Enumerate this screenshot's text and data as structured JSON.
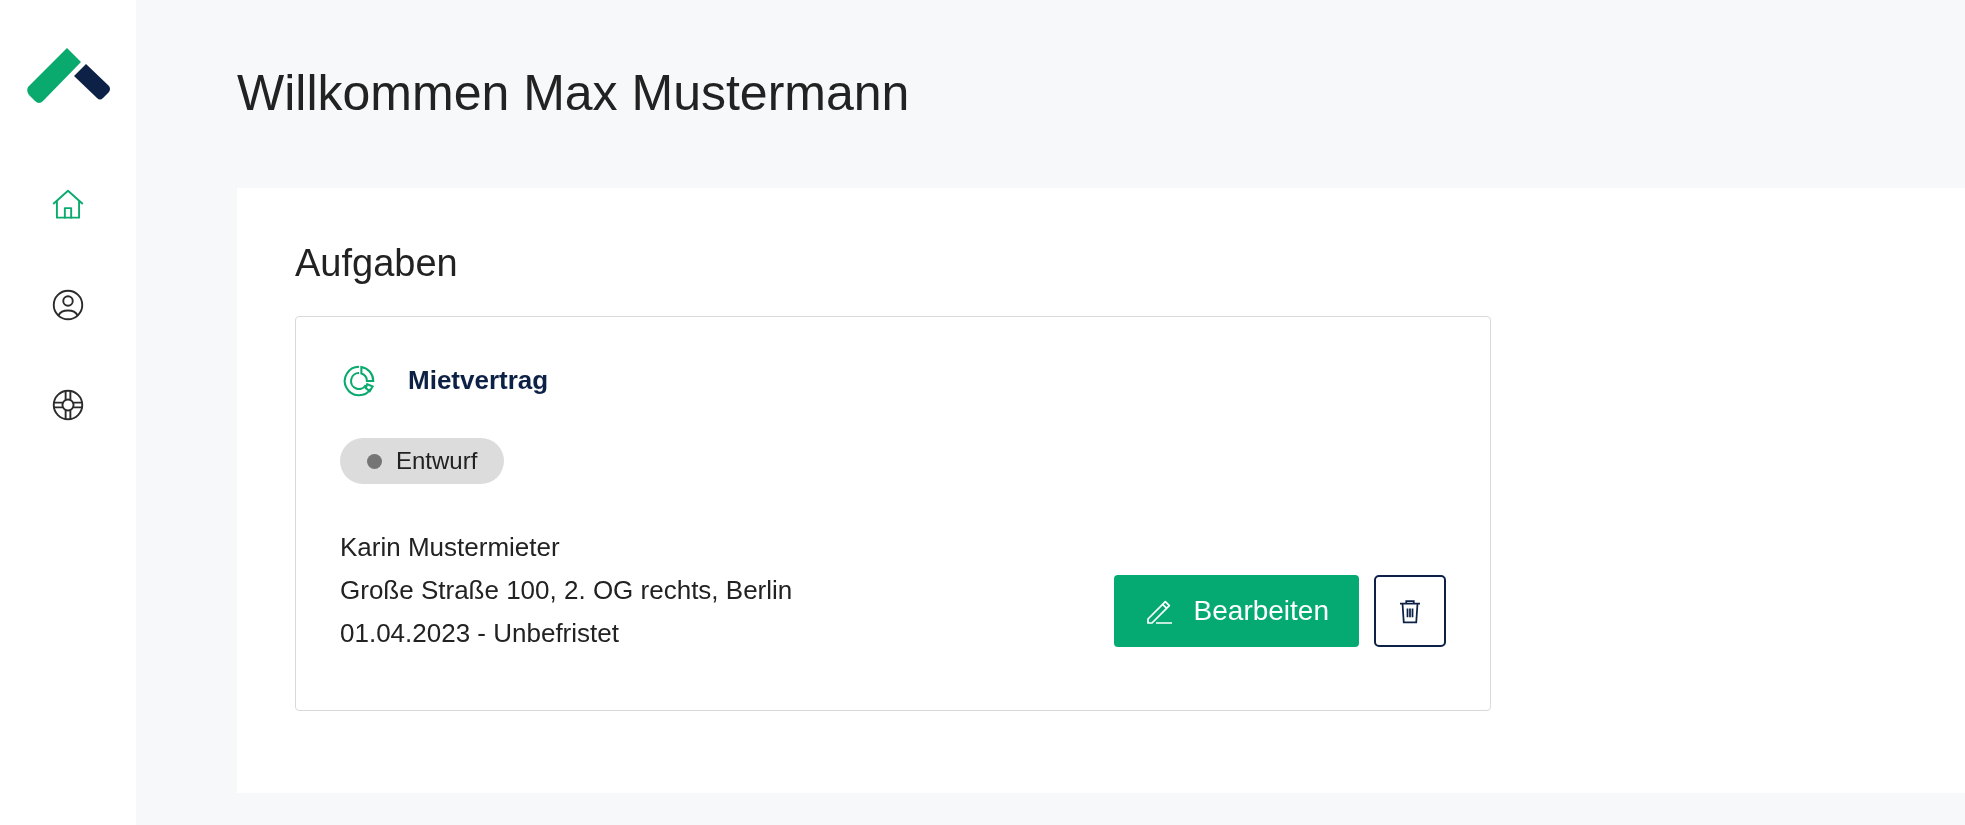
{
  "nav": [
    {
      "kind": "home",
      "selected": true
    },
    {
      "kind": "profile",
      "selected": false
    },
    {
      "kind": "help",
      "selected": false
    }
  ],
  "heading": "Willkommen Max Mustermann",
  "tasks": {
    "title": "Aufgaben",
    "cards": [
      {
        "title": "Mietvertrag",
        "status": {
          "label": "Entwurf",
          "color": "#757575"
        },
        "lines": [
          "Karin Mustermieter",
          "Große Straße 100, 2. OG rechts, Berlin",
          "01.04.2023 - Unbefristet"
        ],
        "edit_label": "Bearbeiten"
      }
    ]
  }
}
